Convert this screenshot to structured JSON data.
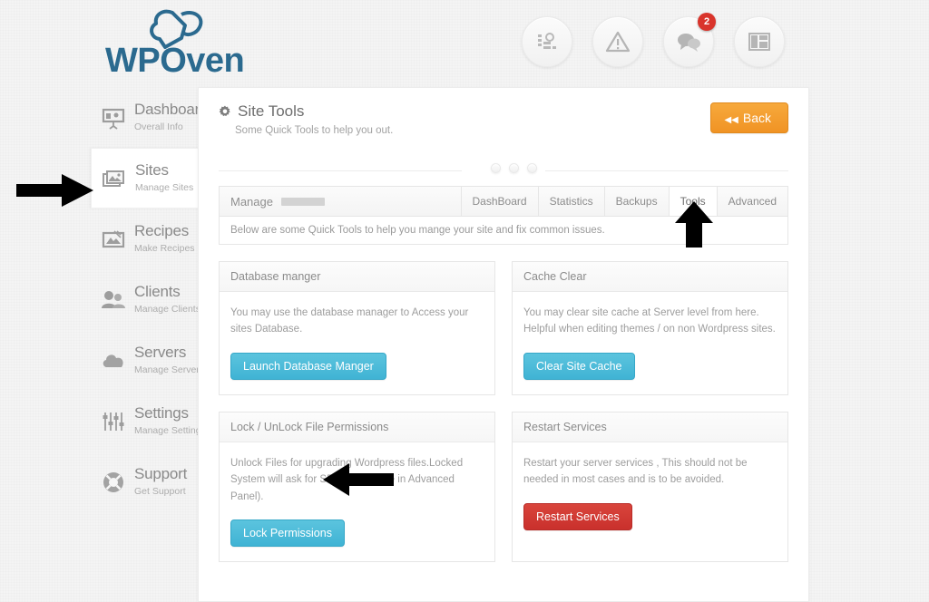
{
  "brand": {
    "name": "WPOven",
    "logo_icon": "chef-hat-icon",
    "color": "#2b6a8f"
  },
  "header": {
    "icons": [
      {
        "name": "server-stats-icon",
        "badge": null
      },
      {
        "name": "warning-triangle-icon",
        "badge": null
      },
      {
        "name": "chat-bubbles-icon",
        "badge": "2"
      },
      {
        "name": "layout-grid-icon",
        "badge": null
      }
    ],
    "badge_color": "#d9342b"
  },
  "sidebar": {
    "items": [
      {
        "title": "Dashboard",
        "subtitle": "Overall Info",
        "icon": "presentation-board-icon",
        "active": false
      },
      {
        "title": "Sites",
        "subtitle": "Manage Sites",
        "icon": "images-stack-icon",
        "active": true
      },
      {
        "title": "Recipes",
        "subtitle": "Make Recipes",
        "icon": "recipe-card-icon",
        "active": false
      },
      {
        "title": "Clients",
        "subtitle": "Manage Clients",
        "icon": "people-icon",
        "active": false
      },
      {
        "title": "Servers",
        "subtitle": "Manage Servers",
        "icon": "cloud-icon",
        "active": false
      },
      {
        "title": "Settings",
        "subtitle": "Manage Settings",
        "icon": "sliders-icon",
        "active": false
      },
      {
        "title": "Support",
        "subtitle": "Get Support",
        "icon": "lifebuoy-icon",
        "active": false
      }
    ]
  },
  "main": {
    "title": "Site Tools",
    "title_icon": "gear-icon",
    "subtitle": "Some Quick Tools to help you out.",
    "back_label": "Back",
    "back_icon": "double-chevron-left-icon",
    "back_color": "#f09324",
    "manage_label": "Manage",
    "tabs": [
      {
        "label": "DashBoard",
        "active": false
      },
      {
        "label": "Statistics",
        "active": false
      },
      {
        "label": "Backups",
        "active": false
      },
      {
        "label": "Tools",
        "active": true
      },
      {
        "label": "Advanced",
        "active": false
      }
    ],
    "tab_description": "Below are some Quick Tools to help you mange your site and fix common issues.",
    "panels": [
      {
        "title": "Database manger",
        "text": "You may use the database manager to Access your sites Database.",
        "button_label": "Launch Database Manger",
        "button_style": "info",
        "button_color": "#40b3d4"
      },
      {
        "title": "Cache Clear",
        "text": "You may clear site cache at Server level from here. Helpful when editing themes / on non Wordpress sites.",
        "button_label": "Clear Site Cache",
        "button_style": "info",
        "button_color": "#40b3d4"
      },
      {
        "title": "Lock / UnLock File Permissions",
        "text": "Unlock Files for upgrading Wordpress files.Locked System will ask for SFTP (Available in Advanced Panel).",
        "button_label": "Lock Permissions",
        "button_style": "info",
        "button_color": "#40b3d4"
      },
      {
        "title": "Restart Services",
        "text": "Restart your server services , This should not be needed in most cases and is to be avoided.",
        "button_label": "Restart Services",
        "button_style": "danger",
        "button_color": "#c9302c"
      }
    ]
  },
  "annotations": [
    {
      "name": "arrow-pointing-to-sites",
      "direction": "right"
    },
    {
      "name": "arrow-pointing-to-tools-tab",
      "direction": "up"
    },
    {
      "name": "arrow-pointing-to-lock-permissions",
      "direction": "left"
    }
  ]
}
